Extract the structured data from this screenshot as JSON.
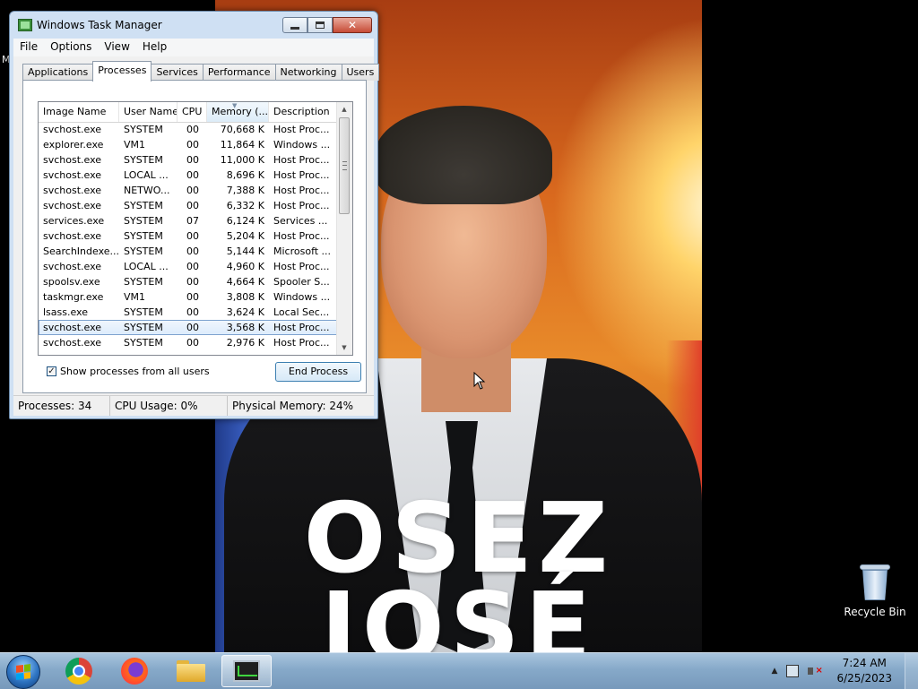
{
  "desktop": {
    "wallpaper": {
      "headline_line1": "OSEZ",
      "headline_line2": "JOSÉ"
    },
    "stray_label": "M",
    "icons": [
      {
        "label": "Recycle Bin",
        "icon": "recycle-bin-icon"
      }
    ]
  },
  "task_manager": {
    "title": "Windows Task Manager",
    "window_buttons": {
      "minimize": "minimize-icon",
      "maximize": "maximize-icon",
      "close": "close-icon"
    },
    "menu": [
      "File",
      "Options",
      "View",
      "Help"
    ],
    "tabs": [
      {
        "label": "Applications",
        "active": false
      },
      {
        "label": "Processes",
        "active": true
      },
      {
        "label": "Services",
        "active": false
      },
      {
        "label": "Performance",
        "active": false
      },
      {
        "label": "Networking",
        "active": false
      },
      {
        "label": "Users",
        "active": false
      }
    ],
    "columns": [
      "Image Name",
      "User Name",
      "CPU",
      "Memory (...",
      "Description"
    ],
    "sorted_column": "Memory (...",
    "rows": [
      {
        "image": "svchost.exe",
        "user": "SYSTEM",
        "cpu": "00",
        "memory": "70,668 K",
        "desc": "Host Proc...",
        "selected": false
      },
      {
        "image": "explorer.exe",
        "user": "VM1",
        "cpu": "00",
        "memory": "11,864 K",
        "desc": "Windows ...",
        "selected": false
      },
      {
        "image": "svchost.exe",
        "user": "SYSTEM",
        "cpu": "00",
        "memory": "11,000 K",
        "desc": "Host Proc...",
        "selected": false
      },
      {
        "image": "svchost.exe",
        "user": "LOCAL ...",
        "cpu": "00",
        "memory": "8,696 K",
        "desc": "Host Proc...",
        "selected": false
      },
      {
        "image": "svchost.exe",
        "user": "NETWO...",
        "cpu": "00",
        "memory": "7,388 K",
        "desc": "Host Proc...",
        "selected": false
      },
      {
        "image": "svchost.exe",
        "user": "SYSTEM",
        "cpu": "00",
        "memory": "6,332 K",
        "desc": "Host Proc...",
        "selected": false
      },
      {
        "image": "services.exe",
        "user": "SYSTEM",
        "cpu": "07",
        "memory": "6,124 K",
        "desc": "Services ...",
        "selected": false
      },
      {
        "image": "svchost.exe",
        "user": "SYSTEM",
        "cpu": "00",
        "memory": "5,204 K",
        "desc": "Host Proc...",
        "selected": false
      },
      {
        "image": "SearchIndexe...",
        "user": "SYSTEM",
        "cpu": "00",
        "memory": "5,144 K",
        "desc": "Microsoft ...",
        "selected": false
      },
      {
        "image": "svchost.exe",
        "user": "LOCAL ...",
        "cpu": "00",
        "memory": "4,960 K",
        "desc": "Host Proc...",
        "selected": false
      },
      {
        "image": "spoolsv.exe",
        "user": "SYSTEM",
        "cpu": "00",
        "memory": "4,664 K",
        "desc": "Spooler S...",
        "selected": false
      },
      {
        "image": "taskmgr.exe",
        "user": "VM1",
        "cpu": "00",
        "memory": "3,808 K",
        "desc": "Windows ...",
        "selected": false
      },
      {
        "image": "lsass.exe",
        "user": "SYSTEM",
        "cpu": "00",
        "memory": "3,624 K",
        "desc": "Local Sec...",
        "selected": false
      },
      {
        "image": "svchost.exe",
        "user": "SYSTEM",
        "cpu": "00",
        "memory": "3,568 K",
        "desc": "Host Proc...",
        "selected": true
      },
      {
        "image": "svchost.exe",
        "user": "SYSTEM",
        "cpu": "00",
        "memory": "2,976 K",
        "desc": "Host Proc...",
        "selected": false
      }
    ],
    "show_all_label": "Show processes from all users",
    "show_all_checked": true,
    "end_process_label": "End Process",
    "status": {
      "processes": "Processes: 34",
      "cpu": "CPU Usage: 0%",
      "memory": "Physical Memory: 24%"
    }
  },
  "taskbar": {
    "start": "windows-start-icon",
    "pinned": [
      {
        "name": "chrome-icon",
        "active": false
      },
      {
        "name": "firefox-icon",
        "active": false
      },
      {
        "name": "file-explorer-icon",
        "active": false
      },
      {
        "name": "task-manager-icon",
        "active": true
      }
    ],
    "tray": {
      "time": "7:24 AM",
      "date": "6/25/2023"
    }
  }
}
